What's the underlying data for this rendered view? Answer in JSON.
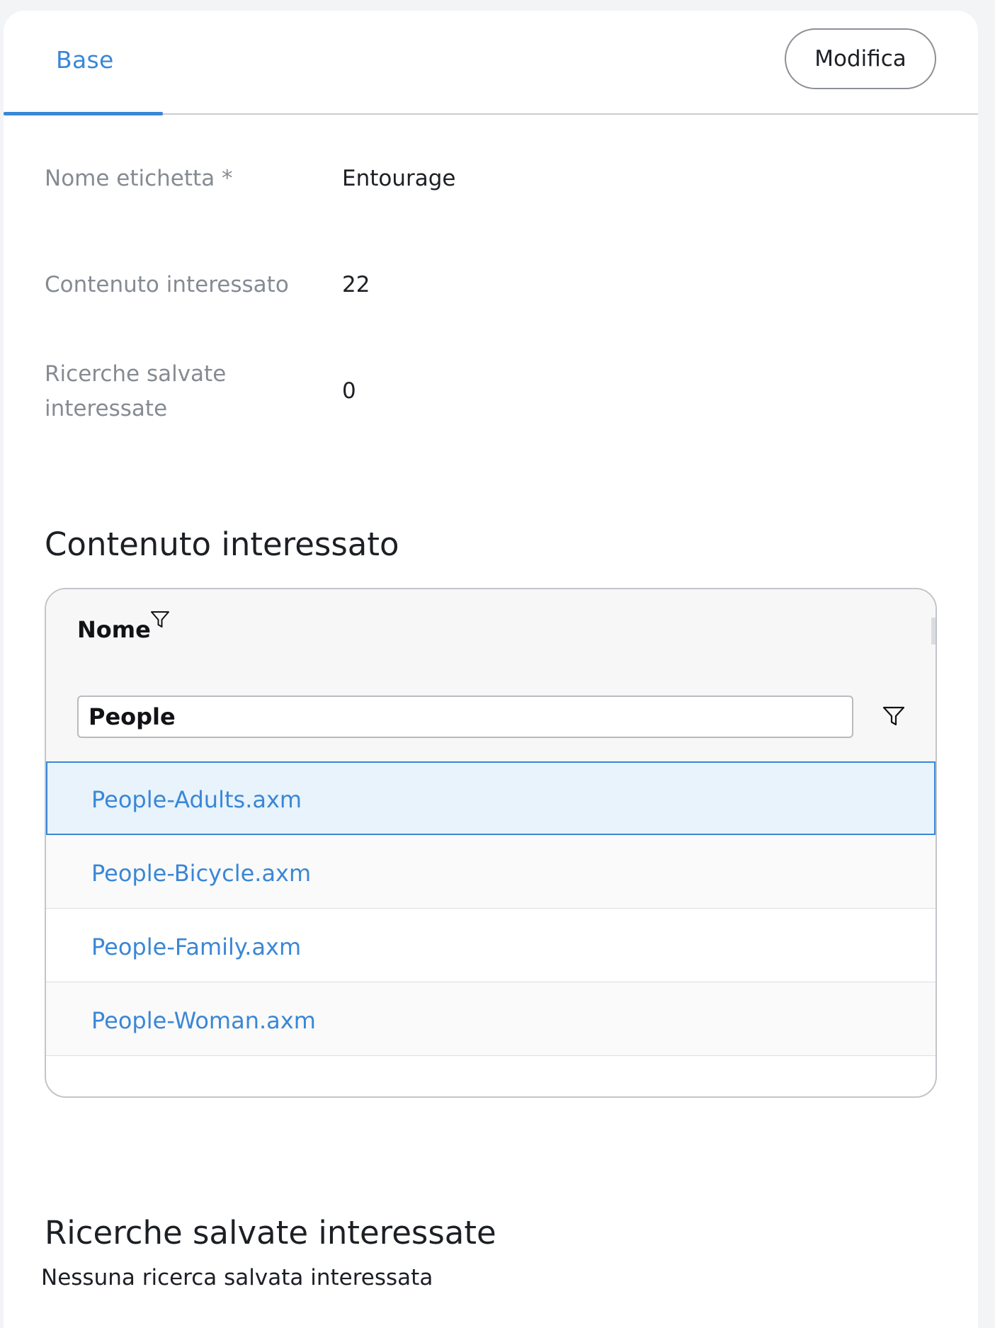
{
  "tabs": [
    {
      "label": "Base",
      "active": true
    }
  ],
  "header": {
    "edit_label": "Modifica"
  },
  "properties": [
    {
      "label": "Nome etichetta *",
      "value": "Entourage"
    },
    {
      "label": "Contenuto interessato",
      "value": "22"
    },
    {
      "label_line1": "Ricerche salvate",
      "label_line2": "interessate",
      "value": "0"
    }
  ],
  "content_section": {
    "title": "Contenuto interessato",
    "table": {
      "column": "Nome",
      "filter_value": "People",
      "rows": [
        {
          "name": "People-Adults.axm",
          "selected": true
        },
        {
          "name": "People-Bicycle.axm"
        },
        {
          "name": "People-Family.axm"
        },
        {
          "name": "People-Woman.axm"
        }
      ]
    }
  },
  "searches_section": {
    "title": "Ricerche salvate interessate",
    "empty_text": "Nessuna ricerca salvata interessata"
  },
  "colors": {
    "accent": "#3a87d6",
    "selected_row_bg": "#e8f3fc",
    "label_gray": "#868b92"
  },
  "icons": [
    "filter-icon"
  ]
}
